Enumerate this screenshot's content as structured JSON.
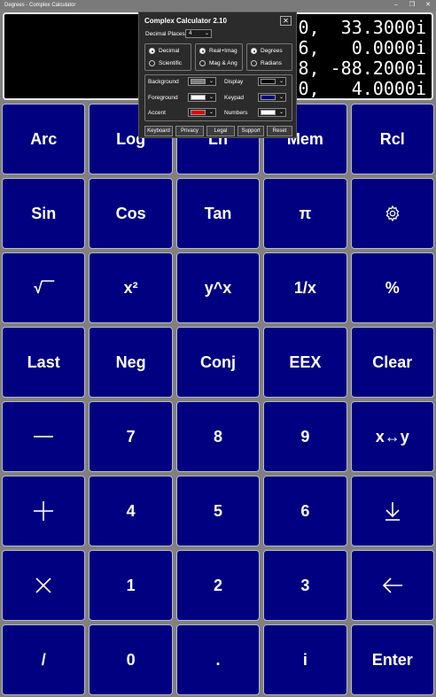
{
  "window": {
    "title": "Degrees - Complex Calculator",
    "controls": [
      "–",
      "❐",
      "✕"
    ]
  },
  "display": {
    "lines": [
      "0,  33.3000i",
      "6,   0.0000i",
      "8, -88.2000i",
      "0,   4.0000i"
    ]
  },
  "keypad": {
    "rows": [
      [
        "Arc",
        "Log",
        "Ln",
        "Mem",
        "Rcl"
      ],
      [
        "Sin",
        "Cos",
        "Tan",
        "π",
        "gear-icon"
      ],
      [
        "√‾‾",
        "x²",
        "y^x",
        "1/x",
        "%"
      ],
      [
        "Last",
        "Neg",
        "Conj",
        "EEX",
        "Clear"
      ],
      [
        "minus-icon",
        "7",
        "8",
        "9",
        "x↔y"
      ],
      [
        "plus-icon",
        "4",
        "5",
        "6",
        "enter-down-icon"
      ],
      [
        "multiply-icon",
        "1",
        "2",
        "3",
        "backspace-icon"
      ],
      [
        "/",
        "0",
        ".",
        "i",
        "Enter"
      ]
    ]
  },
  "dialog": {
    "title": "Complex Calculator 2.10",
    "close": "✕",
    "decimal_places_label": "Decimal Places",
    "decimal_places_value": "4",
    "number_format": {
      "options": [
        "Decimal",
        "Scientific"
      ],
      "selected": "Decimal"
    },
    "complex_format": {
      "options": [
        "Real+Imag",
        "Mag & Ang"
      ],
      "selected": "Real+Imag"
    },
    "angle_units": {
      "options": [
        "Degrees",
        "Radians"
      ],
      "selected": "Degrees"
    },
    "colors": [
      {
        "label": "Background",
        "value": "#808080"
      },
      {
        "label": "Display",
        "value": "#000000"
      },
      {
        "label": "Foreground",
        "value": "#ffffff"
      },
      {
        "label": "Keypad",
        "value": "#000080"
      },
      {
        "label": "Accent",
        "value": "#e00000"
      },
      {
        "label": "Numbers",
        "value": "#ffffff"
      }
    ],
    "buttons": [
      "Keyboard",
      "Privacy",
      "Legal",
      "Support",
      "Reset"
    ]
  },
  "theme": {
    "keypad_color": "#000080",
    "background_color": "#808080",
    "display_color": "#000000"
  }
}
